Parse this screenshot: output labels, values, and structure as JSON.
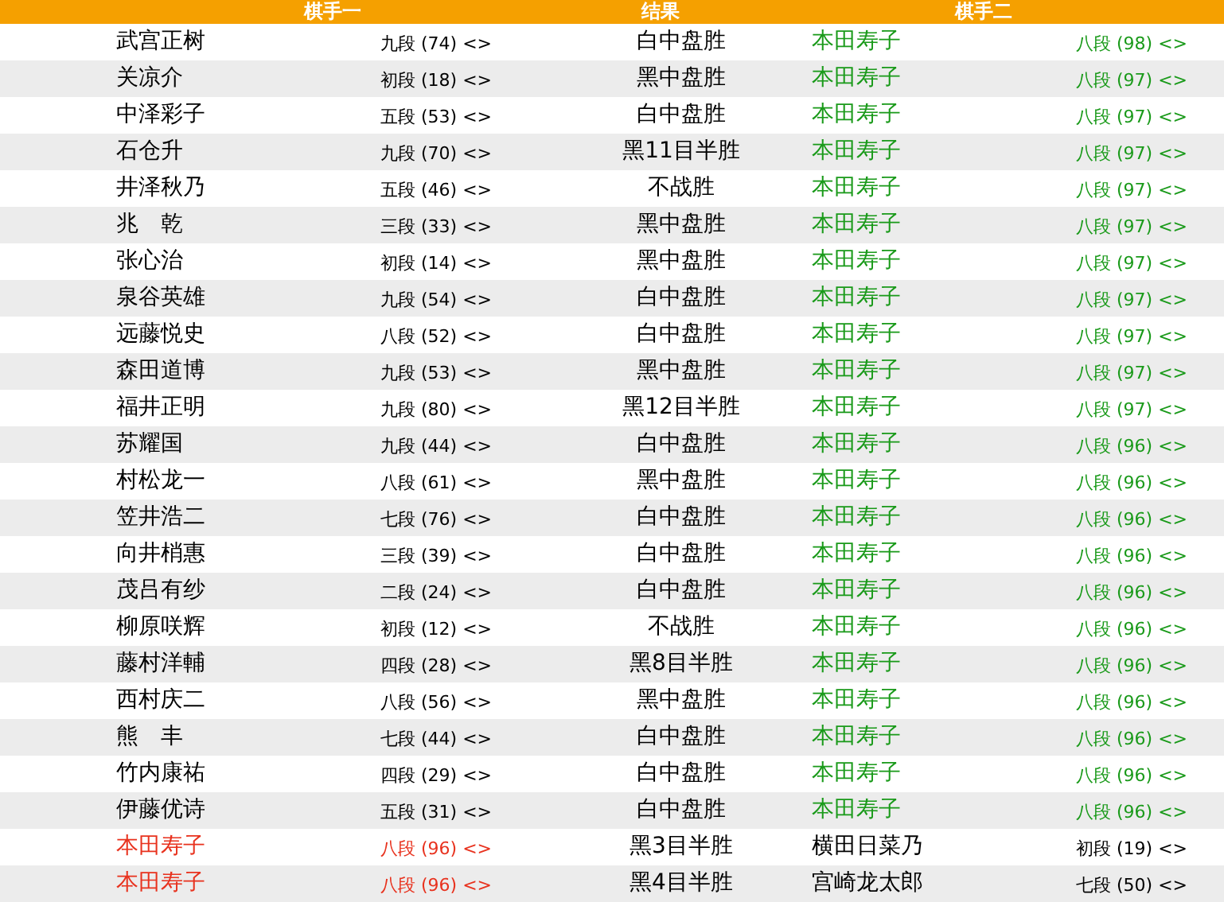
{
  "columns": [
    "棋手一",
    "结果",
    "棋手二"
  ],
  "rows": [
    {
      "p1": {
        "name": "武宫正树",
        "rank": "九段 (74) <>",
        "color": "#000000"
      },
      "result": "白中盘胜",
      "p2": {
        "name": "本田寿子",
        "rank": "八段 (98) <>",
        "color": "#1a9a1a"
      }
    },
    {
      "p1": {
        "name": "关凉介",
        "rank": "初段 (18) <>",
        "color": "#000000"
      },
      "result": "黑中盘胜",
      "p2": {
        "name": "本田寿子",
        "rank": "八段 (97) <>",
        "color": "#1a9a1a"
      }
    },
    {
      "p1": {
        "name": "中泽彩子",
        "rank": "五段 (53) <>",
        "color": "#000000"
      },
      "result": "白中盘胜",
      "p2": {
        "name": "本田寿子",
        "rank": "八段 (97) <>",
        "color": "#1a9a1a"
      }
    },
    {
      "p1": {
        "name": "石仓升",
        "rank": "九段 (70) <>",
        "color": "#000000"
      },
      "result": "黑11目半胜",
      "p2": {
        "name": "本田寿子",
        "rank": "八段 (97) <>",
        "color": "#1a9a1a"
      }
    },
    {
      "p1": {
        "name": "井泽秋乃",
        "rank": "五段 (46) <>",
        "color": "#000000"
      },
      "result": "不战胜",
      "p2": {
        "name": "本田寿子",
        "rank": "八段 (97) <>",
        "color": "#1a9a1a"
      }
    },
    {
      "p1": {
        "name": "兆　乾",
        "rank": "三段 (33) <>",
        "color": "#000000"
      },
      "result": "黑中盘胜",
      "p2": {
        "name": "本田寿子",
        "rank": "八段 (97) <>",
        "color": "#1a9a1a"
      }
    },
    {
      "p1": {
        "name": "张心治",
        "rank": "初段 (14) <>",
        "color": "#000000"
      },
      "result": "黑中盘胜",
      "p2": {
        "name": "本田寿子",
        "rank": "八段 (97) <>",
        "color": "#1a9a1a"
      }
    },
    {
      "p1": {
        "name": "泉谷英雄",
        "rank": "九段 (54) <>",
        "color": "#000000"
      },
      "result": "白中盘胜",
      "p2": {
        "name": "本田寿子",
        "rank": "八段 (97) <>",
        "color": "#1a9a1a"
      }
    },
    {
      "p1": {
        "name": "远藤悦史",
        "rank": "八段 (52) <>",
        "color": "#000000"
      },
      "result": "白中盘胜",
      "p2": {
        "name": "本田寿子",
        "rank": "八段 (97) <>",
        "color": "#1a9a1a"
      }
    },
    {
      "p1": {
        "name": "森田道博",
        "rank": "九段 (53) <>",
        "color": "#000000"
      },
      "result": "黑中盘胜",
      "p2": {
        "name": "本田寿子",
        "rank": "八段 (97) <>",
        "color": "#1a9a1a"
      }
    },
    {
      "p1": {
        "name": "福井正明",
        "rank": "九段 (80) <>",
        "color": "#000000"
      },
      "result": "黑12目半胜",
      "p2": {
        "name": "本田寿子",
        "rank": "八段 (97) <>",
        "color": "#1a9a1a"
      }
    },
    {
      "p1": {
        "name": "苏耀国",
        "rank": "九段 (44) <>",
        "color": "#000000"
      },
      "result": "白中盘胜",
      "p2": {
        "name": "本田寿子",
        "rank": "八段 (96) <>",
        "color": "#1a9a1a"
      }
    },
    {
      "p1": {
        "name": "村松龙一",
        "rank": "八段 (61) <>",
        "color": "#000000"
      },
      "result": "黑中盘胜",
      "p2": {
        "name": "本田寿子",
        "rank": "八段 (96) <>",
        "color": "#1a9a1a"
      }
    },
    {
      "p1": {
        "name": "笠井浩二",
        "rank": "七段 (76) <>",
        "color": "#000000"
      },
      "result": "白中盘胜",
      "p2": {
        "name": "本田寿子",
        "rank": "八段 (96) <>",
        "color": "#1a9a1a"
      }
    },
    {
      "p1": {
        "name": "向井梢惠",
        "rank": "三段 (39) <>",
        "color": "#000000"
      },
      "result": "白中盘胜",
      "p2": {
        "name": "本田寿子",
        "rank": "八段 (96) <>",
        "color": "#1a9a1a"
      }
    },
    {
      "p1": {
        "name": "茂吕有纱",
        "rank": "二段 (24) <>",
        "color": "#000000"
      },
      "result": "白中盘胜",
      "p2": {
        "name": "本田寿子",
        "rank": "八段 (96) <>",
        "color": "#1a9a1a"
      }
    },
    {
      "p1": {
        "name": "柳原咲辉",
        "rank": "初段 (12) <>",
        "color": "#000000"
      },
      "result": "不战胜",
      "p2": {
        "name": "本田寿子",
        "rank": "八段 (96) <>",
        "color": "#1a9a1a"
      }
    },
    {
      "p1": {
        "name": "藤村洋輔",
        "rank": "四段 (28) <>",
        "color": "#000000"
      },
      "result": "黑8目半胜",
      "p2": {
        "name": "本田寿子",
        "rank": "八段 (96) <>",
        "color": "#1a9a1a"
      }
    },
    {
      "p1": {
        "name": "西村庆二",
        "rank": "八段 (56) <>",
        "color": "#000000"
      },
      "result": "黑中盘胜",
      "p2": {
        "name": "本田寿子",
        "rank": "八段 (96) <>",
        "color": "#1a9a1a"
      }
    },
    {
      "p1": {
        "name": "熊　丰",
        "rank": "七段 (44) <>",
        "color": "#000000"
      },
      "result": "白中盘胜",
      "p2": {
        "name": "本田寿子",
        "rank": "八段 (96) <>",
        "color": "#1a9a1a"
      }
    },
    {
      "p1": {
        "name": "竹内康祐",
        "rank": "四段 (29) <>",
        "color": "#000000"
      },
      "result": "白中盘胜",
      "p2": {
        "name": "本田寿子",
        "rank": "八段 (96) <>",
        "color": "#1a9a1a"
      }
    },
    {
      "p1": {
        "name": "伊藤优诗",
        "rank": "五段 (31) <>",
        "color": "#000000"
      },
      "result": "白中盘胜",
      "p2": {
        "name": "本田寿子",
        "rank": "八段 (96) <>",
        "color": "#1a9a1a"
      }
    },
    {
      "p1": {
        "name": "本田寿子",
        "rank": "八段 (96) <>",
        "color": "#e8321e"
      },
      "result": "黑3目半胜",
      "p2": {
        "name": "横田日菜乃",
        "rank": "初段 (19) <>",
        "color": "#000000"
      }
    },
    {
      "p1": {
        "name": "本田寿子",
        "rank": "八段 (96) <>",
        "color": "#e8321e"
      },
      "result": "黑4目半胜",
      "p2": {
        "name": "宫崎龙太郎",
        "rank": "七段 (50) <>",
        "color": "#000000"
      }
    }
  ]
}
